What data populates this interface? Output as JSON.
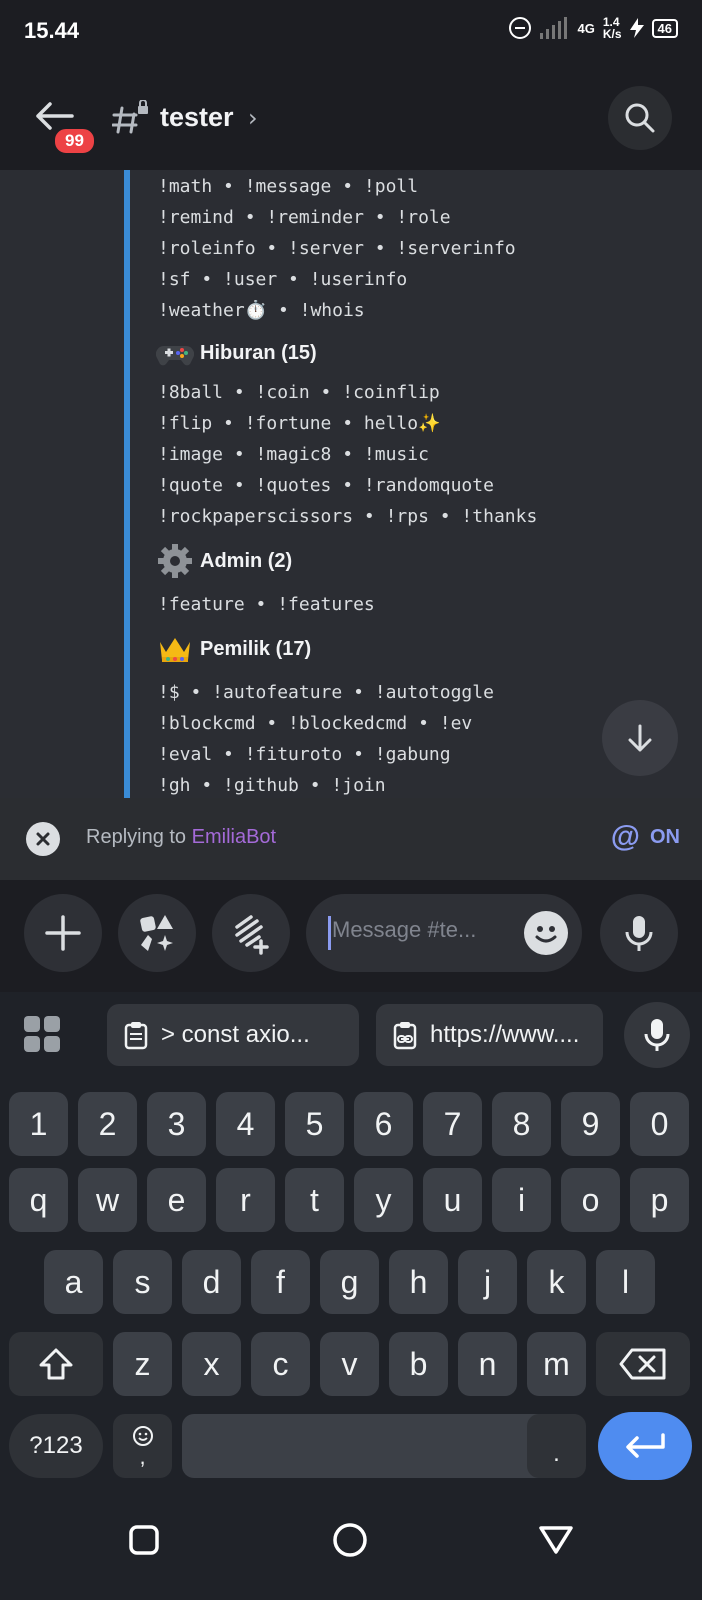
{
  "status_bar": {
    "time": "15.44",
    "net_type": "4G",
    "net_speed": "1.4",
    "net_unit": "K/s",
    "battery": "46"
  },
  "header": {
    "back_badge": "99",
    "channel_name": "tester",
    "chevron": "›"
  },
  "message": {
    "lines_top": [
      "!math • !message • !poll",
      "!remind • !reminder • !role",
      "!roleinfo • !server • !serverinfo",
      "!sf • !user • !userinfo",
      "!weather⏱️ • !whois"
    ],
    "sections": [
      {
        "emoji": "🎮",
        "title": "Hiburan (15)",
        "lines": [
          "!8ball • !coin • !coinflip",
          "!flip • !fortune • hello✨",
          "!image • !magic8 • !music",
          "!quote • !quotes • !randomquote",
          "!rockpaperscissors • !rps • !thanks"
        ]
      },
      {
        "emoji": "⚙️",
        "title": "Admin (2)",
        "lines": [
          "!feature • !features"
        ]
      },
      {
        "emoji": "👑",
        "title": "Pemilik (17)",
        "lines": [
          "!$ • !autofeature • !autotoggle",
          "!blockcmd • !blockedcmd • !ev",
          "!eval • !fituroto • !gabung",
          "!gh • !github • !join"
        ]
      }
    ]
  },
  "reply_bar": {
    "prefix": "Replying to ",
    "user": "EmiliaBot",
    "mention_state": "ON",
    "user_color": "#a46ad8"
  },
  "composer": {
    "placeholder": "Message #te..."
  },
  "keyboard": {
    "suggestions": [
      ">  const axio...",
      "https://www...."
    ],
    "row_numbers": [
      "1",
      "2",
      "3",
      "4",
      "5",
      "6",
      "7",
      "8",
      "9",
      "0"
    ],
    "row1": [
      "q",
      "w",
      "e",
      "r",
      "t",
      "y",
      "u",
      "i",
      "o",
      "p"
    ],
    "row2": [
      "a",
      "s",
      "d",
      "f",
      "g",
      "h",
      "j",
      "k",
      "l"
    ],
    "row3": [
      "z",
      "x",
      "c",
      "v",
      "b",
      "n",
      "m"
    ],
    "symbols_key": "?123",
    "comma_key": ",",
    "period_key": "."
  },
  "colors": {
    "accent": "#3a8bd6",
    "enter": "#4f8cf0",
    "badge": "#ed4245"
  }
}
